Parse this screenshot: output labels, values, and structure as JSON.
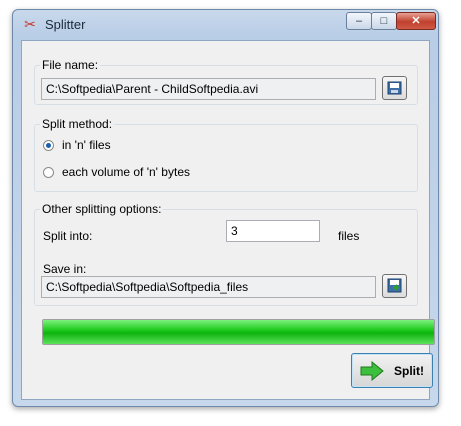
{
  "window": {
    "title": "Splitter",
    "icon": "scissors-icon"
  },
  "controls": {
    "minimize": "–",
    "maximize": "□",
    "close": "✕"
  },
  "file": {
    "legend": "File name:",
    "path": "C:\\Softpedia\\Parent - ChildSoftpedia.avi",
    "browse_icon": "open-file-icon"
  },
  "method": {
    "legend": "Split method:",
    "options": [
      {
        "label": "in 'n' files",
        "selected": true
      },
      {
        "label": "each volume of 'n' bytes",
        "selected": false
      }
    ]
  },
  "other": {
    "legend": "Other splitting options:",
    "split_into_label": "Split into:",
    "split_into_value": "3",
    "unit": "files",
    "save_in_label": "Save in:",
    "save_in_path": "C:\\Softpedia\\Softpedia\\Softpedia_files",
    "folder_icon": "save-folder-icon"
  },
  "progress": {
    "value": 1.0,
    "color": "#17c617"
  },
  "actions": {
    "split_label": "Split!",
    "split_icon": "green-arrow-icon"
  }
}
